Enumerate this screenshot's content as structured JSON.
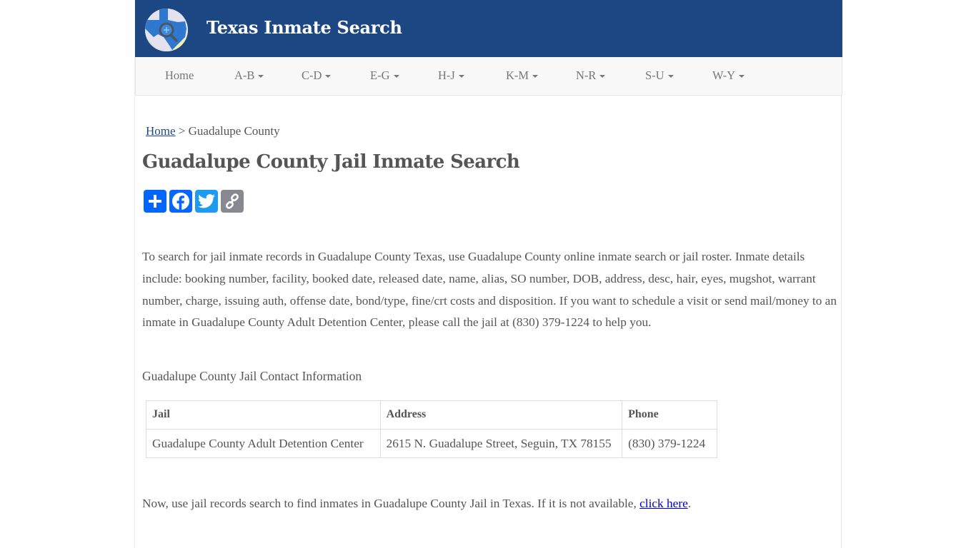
{
  "header": {
    "site_title": "Texas Inmate Search",
    "logo_icon": "texas-map-magnifier-icon",
    "brand_color": "#1c4782"
  },
  "nav": {
    "items": [
      {
        "label": "Home",
        "dropdown": false
      },
      {
        "label": "A-B",
        "dropdown": true
      },
      {
        "label": "C-D",
        "dropdown": true
      },
      {
        "label": "E-G",
        "dropdown": true
      },
      {
        "label": "H-J",
        "dropdown": true
      },
      {
        "label": "K-M",
        "dropdown": true
      },
      {
        "label": "N-R",
        "dropdown": true
      },
      {
        "label": "S-U",
        "dropdown": true
      },
      {
        "label": "W-Y",
        "dropdown": true
      }
    ]
  },
  "breadcrumb": {
    "home_label": "Home",
    "separator": " > ",
    "current": "Guadalupe County"
  },
  "page_title": "Guadalupe County Jail Inmate Search",
  "share": {
    "buttons": [
      {
        "name": "share-add",
        "icon": "plus-icon",
        "color": "#0166ff"
      },
      {
        "name": "share-facebook",
        "icon": "facebook-icon",
        "color": "#0866ff"
      },
      {
        "name": "share-twitter",
        "icon": "twitter-icon",
        "color": "#1d9bf0"
      },
      {
        "name": "share-copy-link",
        "icon": "link-icon",
        "color": "#888990"
      }
    ]
  },
  "intro_text": "To search for jail inmate records in Guadalupe County Texas, use Guadalupe County online inmate search or jail roster. Inmate details include: booking number, facility, booked date, released date, name, alias, SO number, DOB, address, desc, hair, eyes, mugshot, warrant number, charge, issuing auth, offense date, bond/type, fine/crt costs and disposition. If you want to schedule a visit or send mail/money to an inmate in Guadalupe County Adult Detention Center, please call the jail at (830) 379-1224 to help you.",
  "contact_heading": "Guadalupe County Jail Contact Information",
  "contact_table": {
    "headers": [
      "Jail",
      "Address",
      "Phone"
    ],
    "rows": [
      [
        "Guadalupe County Adult Detention Center",
        "2615 N. Guadalupe Street, Seguin, TX 78155",
        "(830) 379-1224"
      ]
    ]
  },
  "outro": {
    "text": "Now, use jail records search to find inmates in Guadalupe County Jail in Texas. If it is not available, ",
    "link_label": "click here",
    "suffix": "."
  }
}
